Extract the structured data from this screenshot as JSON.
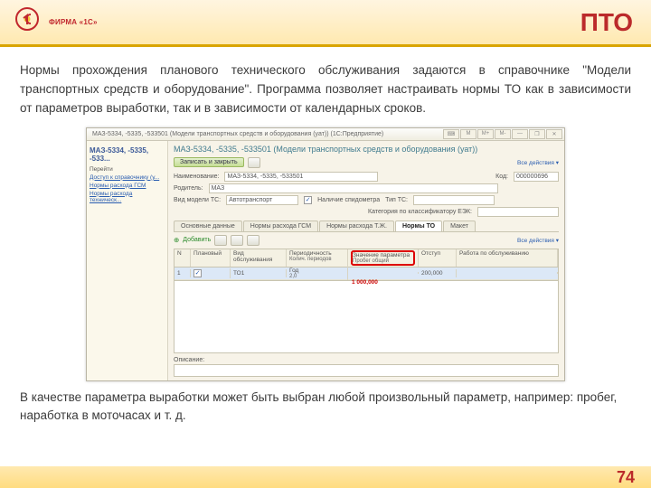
{
  "header": {
    "logo_sub": "ФИРМА «1С»",
    "title": "ПТО"
  },
  "para1": "Нормы прохождения планового технического обслуживания задаются в справочнике \"Модели транспортных средств и оборудование\". Программа позволяет настраивать нормы ТО как в зависимости от параметров выработки, так и в зависимости от календарных сроков.",
  "para2": "В качестве параметра выработки может быть выбран любой произвольный параметр, например: пробег, наработка в моточасах и т. д.",
  "page_number": "74",
  "win": {
    "titlebar": "МАЗ-5334, -5335, -533501 (Модели транспортных средств и оборудования (уат)) (1С:Предприятие)",
    "btn_m": "М",
    "btn_mp": "М+",
    "btn_mm": "М-",
    "left_head": "МАЗ-5334, -5335, -533...",
    "nav_goto": "Перейти",
    "nav_link1": "Доступ к справочнику (у...",
    "nav_link2": "Нормы расхода ГСМ",
    "nav_link3": "Нормы расхода техническ...",
    "doc_title": "МАЗ-5334, -5335, -533501 (Модели транспортных средств и оборудования (уат))",
    "save_close": "Записать и закрыть",
    "all_actions": "Все действия ▾",
    "f_name_lbl": "Наименование:",
    "f_name_val": "МАЗ-5334, -5335, -533501",
    "f_code_lbl": "Код:",
    "f_code_val": "000000696",
    "f_parent_lbl": "Родитель:",
    "f_parent_val": "МАЗ",
    "f_model_lbl": "Вид модели ТС:",
    "f_model_val": "Автотранспорт",
    "f_spid_lbl": "Наличие спидометра",
    "f_tip_lbl": "Тип ТС:",
    "f_ezk_lbl": "Категория по классификатору ЕЭК:",
    "tabs": {
      "t1": "Основные данные",
      "t2": "Нормы расхода ГСМ",
      "t3": "Нормы расхода Т.Ж.",
      "t4": "Нормы ТО",
      "t5": "Макет"
    },
    "add_btn": "Добавить",
    "grid": {
      "h_n": "N",
      "h_plan": "Плановый",
      "h_vo": "Вид обслуживания",
      "h_per": "Периодичность",
      "h_per2": "Колич. периодов",
      "h_zn": "Значение параметра",
      "h_zn2": "Пробег общий",
      "h_ot": "Отступ",
      "h_rb": "Работа по обслуживанию",
      "r_n": "1",
      "r_vo": "ТО1",
      "r_per": "Год",
      "r_per2": "2,0",
      "r_zn_red": "1 000,000",
      "r_ot": "200,000"
    },
    "desc_lbl": "Описание:"
  }
}
